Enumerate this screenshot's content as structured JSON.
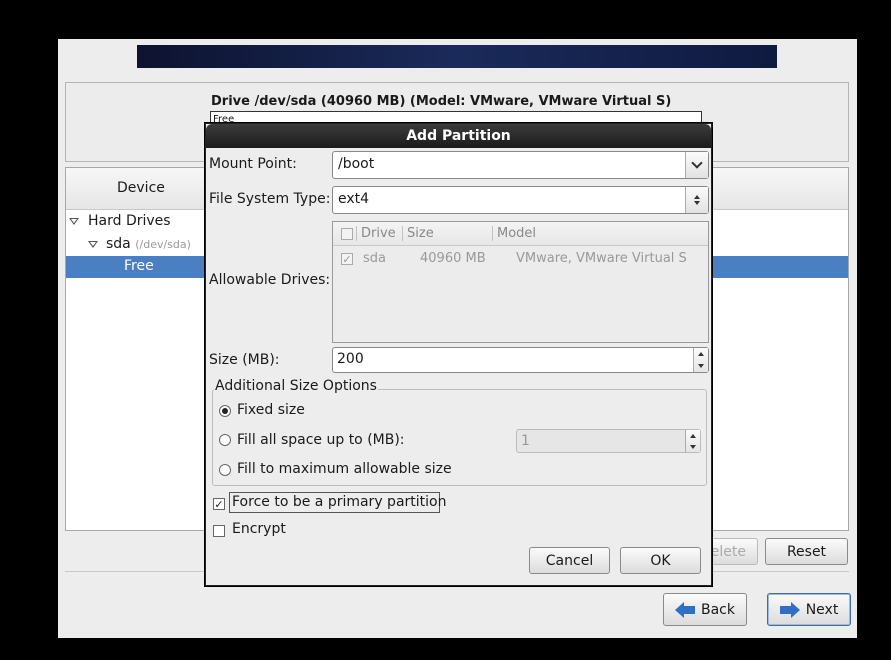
{
  "installer": {
    "drive_title": "Drive /dev/sda (40960 MB) (Model: VMware, VMware Virtual S)",
    "drive_bar_label": "Free",
    "tree": {
      "column_device": "Device",
      "hard_drives": "Hard Drives",
      "sda_name": "sda",
      "sda_path": "(/dev/sda)",
      "free_label": "Free"
    },
    "buttons": {
      "delete": "Delete",
      "reset": "Reset",
      "back": "Back",
      "next": "Next"
    }
  },
  "dialog": {
    "title": "Add Partition",
    "mount_point_label": "Mount Point:",
    "mount_point_value": "/boot",
    "fs_type_label": "File System Type:",
    "fs_type_value": "ext4",
    "allowable_drives_label": "Allowable Drives:",
    "drives_table": {
      "headers": [
        "Drive",
        "Size",
        "Model"
      ],
      "rows": [
        {
          "drive": "sda",
          "size": "40960 MB",
          "model": "VMware, VMware Virtual S",
          "checked": true
        }
      ]
    },
    "size_label": "Size (MB):",
    "size_value": "200",
    "size_options_label": "Additional Size Options",
    "opt_fixed": "Fixed size",
    "opt_fill_upto": "Fill all space up to (MB):",
    "opt_fill_upto_value": "1",
    "opt_fill_max": "Fill to maximum allowable size",
    "selected_size_option": "fixed",
    "force_primary_label": "Force to be a primary partition",
    "force_primary_checked": true,
    "encrypt_label": "Encrypt",
    "encrypt_checked": false,
    "cancel_label": "Cancel",
    "ok_label": "OK"
  }
}
